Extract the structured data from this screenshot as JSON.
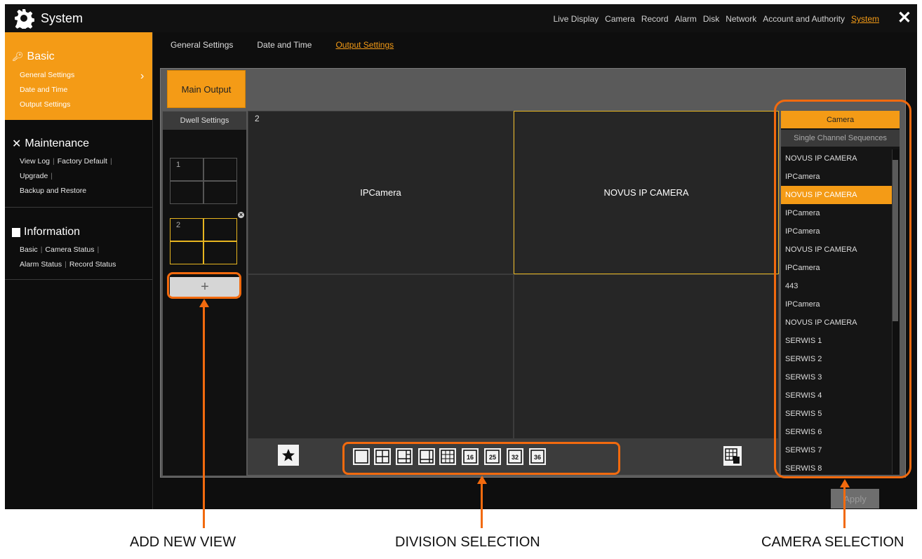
{
  "app": {
    "title": "System",
    "icon": "gear-icon",
    "close_icon": "close-icon"
  },
  "top_nav": [
    "Live Display",
    "Camera",
    "Record",
    "Alarm",
    "Disk",
    "Network",
    "Account and Authority",
    "System"
  ],
  "top_nav_active": "System",
  "sidebar": {
    "basic": {
      "title": "Basic",
      "icon": "key-icon",
      "items": [
        "General Settings",
        "Date and Time",
        "Output Settings"
      ]
    },
    "maintenance": {
      "title": "Maintenance",
      "icon": "tools-icon",
      "line1": [
        "View Log",
        "Factory Default"
      ],
      "line2": [
        "Upgrade"
      ],
      "line3": [
        "Backup and Restore"
      ]
    },
    "information": {
      "title": "Information",
      "icon": "monitor-icon",
      "line1": [
        "Basic",
        "Camera Status"
      ],
      "line2": [
        "Alarm Status",
        "Record Status"
      ]
    }
  },
  "sub_tabs": [
    "General Settings",
    "Date and Time",
    "Output Settings"
  ],
  "sub_tab_active": "Output Settings",
  "main_output_label": "Main Output",
  "dwell": {
    "title": "Dwell Settings",
    "views": [
      {
        "number": "1"
      },
      {
        "number": "2"
      }
    ],
    "add_label": "+"
  },
  "view_number": "2",
  "cells": [
    "IPCamera",
    "NOVUS IP CAMERA",
    "",
    ""
  ],
  "division_options": [
    "1",
    "4",
    "6",
    "8",
    "9",
    "16",
    "25",
    "32",
    "36"
  ],
  "camera_panel": {
    "header": "Camera",
    "sequences": "Single Channel Sequences",
    "items": [
      "NOVUS IP CAMERA",
      "IPCamera",
      "NOVUS IP CAMERA",
      "IPCamera",
      "IPCamera",
      "NOVUS IP CAMERA",
      "IPCamera",
      "443",
      "IPCamera",
      "NOVUS IP CAMERA",
      "SERWIS  1",
      "SERWIS  2",
      "SERWIS  3",
      "SERWIS  4",
      "SERWIS  5",
      "SERWIS  6",
      "SERWIS  7",
      "SERWIS  8"
    ],
    "selected_index": 2
  },
  "apply_label": "Apply",
  "annotations": [
    "ADD NEW VIEW",
    "DIVISION SELECTION",
    "CAMERA SELECTION"
  ],
  "colors": {
    "accent": "#f49b16",
    "annotation": "#f26a0e",
    "selection": "#e7b520"
  }
}
